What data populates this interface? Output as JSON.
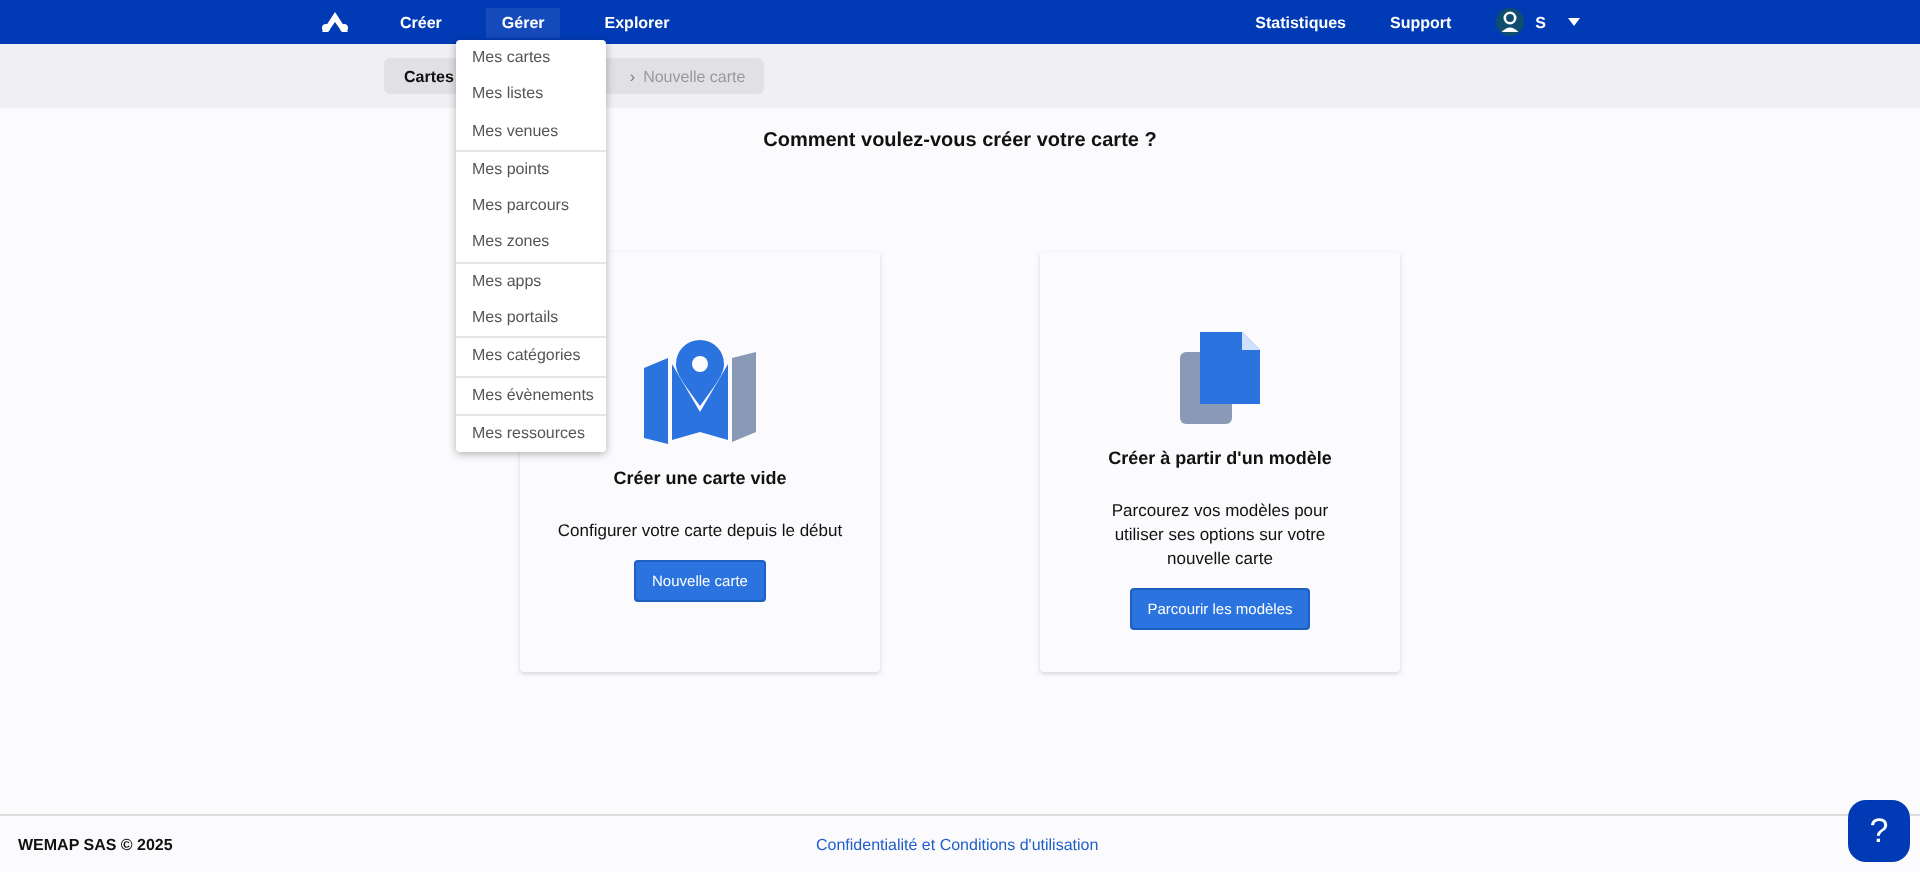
{
  "nav": {
    "items": [
      {
        "label": "Créer",
        "selected": false
      },
      {
        "label": "Gérer",
        "selected": true
      },
      {
        "label": "Explorer",
        "selected": false
      }
    ],
    "right": [
      "Statistiques",
      "Support"
    ],
    "user": "S"
  },
  "manage_menu": {
    "groups": [
      [
        "Mes cartes",
        "Mes listes",
        "Mes venues"
      ],
      [
        "Mes points",
        "Mes parcours",
        "Mes zones"
      ],
      [
        "Mes apps",
        "Mes portails"
      ],
      [
        "Mes catégories"
      ],
      [
        "Mes évènements"
      ],
      [
        "Mes ressources"
      ]
    ]
  },
  "breadcrumb": [
    "Cartes",
    "›",
    "Nouvelle carte"
  ],
  "heading": "Comment voulez-vous créer votre carte ?",
  "cards": [
    {
      "kind": "blank",
      "title": "Créer une carte vide",
      "description": "Configurer votre carte depuis le début",
      "button": "Nouvelle carte"
    },
    {
      "kind": "template",
      "title": "Créer à partir d'un modèle",
      "description": "Parcourez vos modèles pour utiliser ses options sur votre nouvelle carte",
      "button": "Parcourir les modèles"
    }
  ],
  "footer": {
    "copyright": "WEMAP SAS © 2025",
    "link": "Confidentialité et Conditions d'utilisation",
    "help": "?"
  }
}
